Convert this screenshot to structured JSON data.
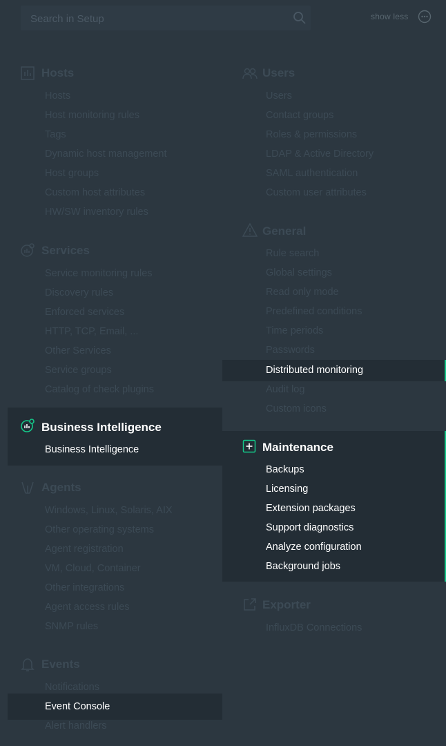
{
  "search": {
    "placeholder": "Search in Setup",
    "show_less_label": "show less"
  },
  "hosts": {
    "title": "Hosts",
    "items": [
      "Hosts",
      "Host monitoring rules",
      "Tags",
      "Dynamic host management",
      "Host groups",
      "Custom host attributes",
      "HW/SW inventory rules"
    ]
  },
  "services": {
    "title": "Services",
    "items": [
      "Service monitoring rules",
      "Discovery rules",
      "Enforced services",
      "HTTP, TCP, Email, ...",
      "Other Services",
      "Service groups",
      "Catalog of check plugins"
    ]
  },
  "business_intelligence": {
    "title": "Business Intelligence",
    "items": [
      "Business Intelligence"
    ]
  },
  "agents": {
    "title": "Agents",
    "items": [
      "Windows, Linux, Solaris, AIX",
      "Other operating systems",
      "Agent registration",
      "VM, Cloud, Container",
      "Other integrations",
      "Agent access rules",
      "SNMP rules"
    ]
  },
  "events": {
    "title": "Events",
    "items": [
      "Notifications",
      "Event Console",
      "Alert handlers"
    ]
  },
  "users": {
    "title": "Users",
    "items": [
      "Users",
      "Contact groups",
      "Roles & permissions",
      "LDAP & Active Directory",
      "SAML authentication",
      "Custom user attributes"
    ]
  },
  "general": {
    "title": "General",
    "items": [
      "Rule search",
      "Global settings",
      "Read only mode",
      "Predefined conditions",
      "Time periods",
      "Passwords",
      "Distributed monitoring",
      "Audit log",
      "Custom icons"
    ]
  },
  "maintenance": {
    "title": "Maintenance",
    "items": [
      "Backups",
      "Licensing",
      "Extension packages",
      "Support diagnostics",
      "Analyze configuration",
      "Background jobs"
    ]
  },
  "exporter": {
    "title": "Exporter",
    "items": [
      "InfluxDB Connections"
    ]
  },
  "colors": {
    "background": "#2c3740",
    "dim_text": "#3c4a55",
    "highlight_bg": "#232d35",
    "accent": "#14c889",
    "active_text": "#ffffff"
  }
}
